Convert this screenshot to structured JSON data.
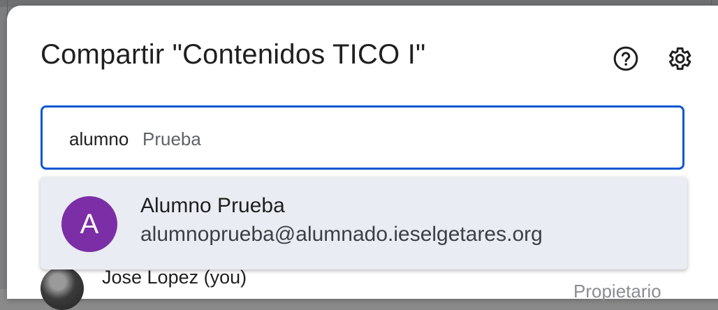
{
  "dialog": {
    "title": "Compartir \"Contenidos TICO I\"",
    "help_icon": "help-circle-icon",
    "settings_icon": "gear-icon"
  },
  "search": {
    "typed_value": "alumno",
    "autocomplete_suggestion": "Prueba"
  },
  "suggestions": [
    {
      "avatar_letter": "A",
      "avatar_color": "#7b2ea6",
      "name": "Alumno Prueba",
      "email": "alumnoprueba@alumnado.ieselgetares.org"
    }
  ],
  "people": [
    {
      "name": "Jose Lopez (you)",
      "role": "Propietario"
    }
  ],
  "colors": {
    "focus_border": "#0b57d0",
    "dropdown_bg": "#e9ecf3"
  }
}
